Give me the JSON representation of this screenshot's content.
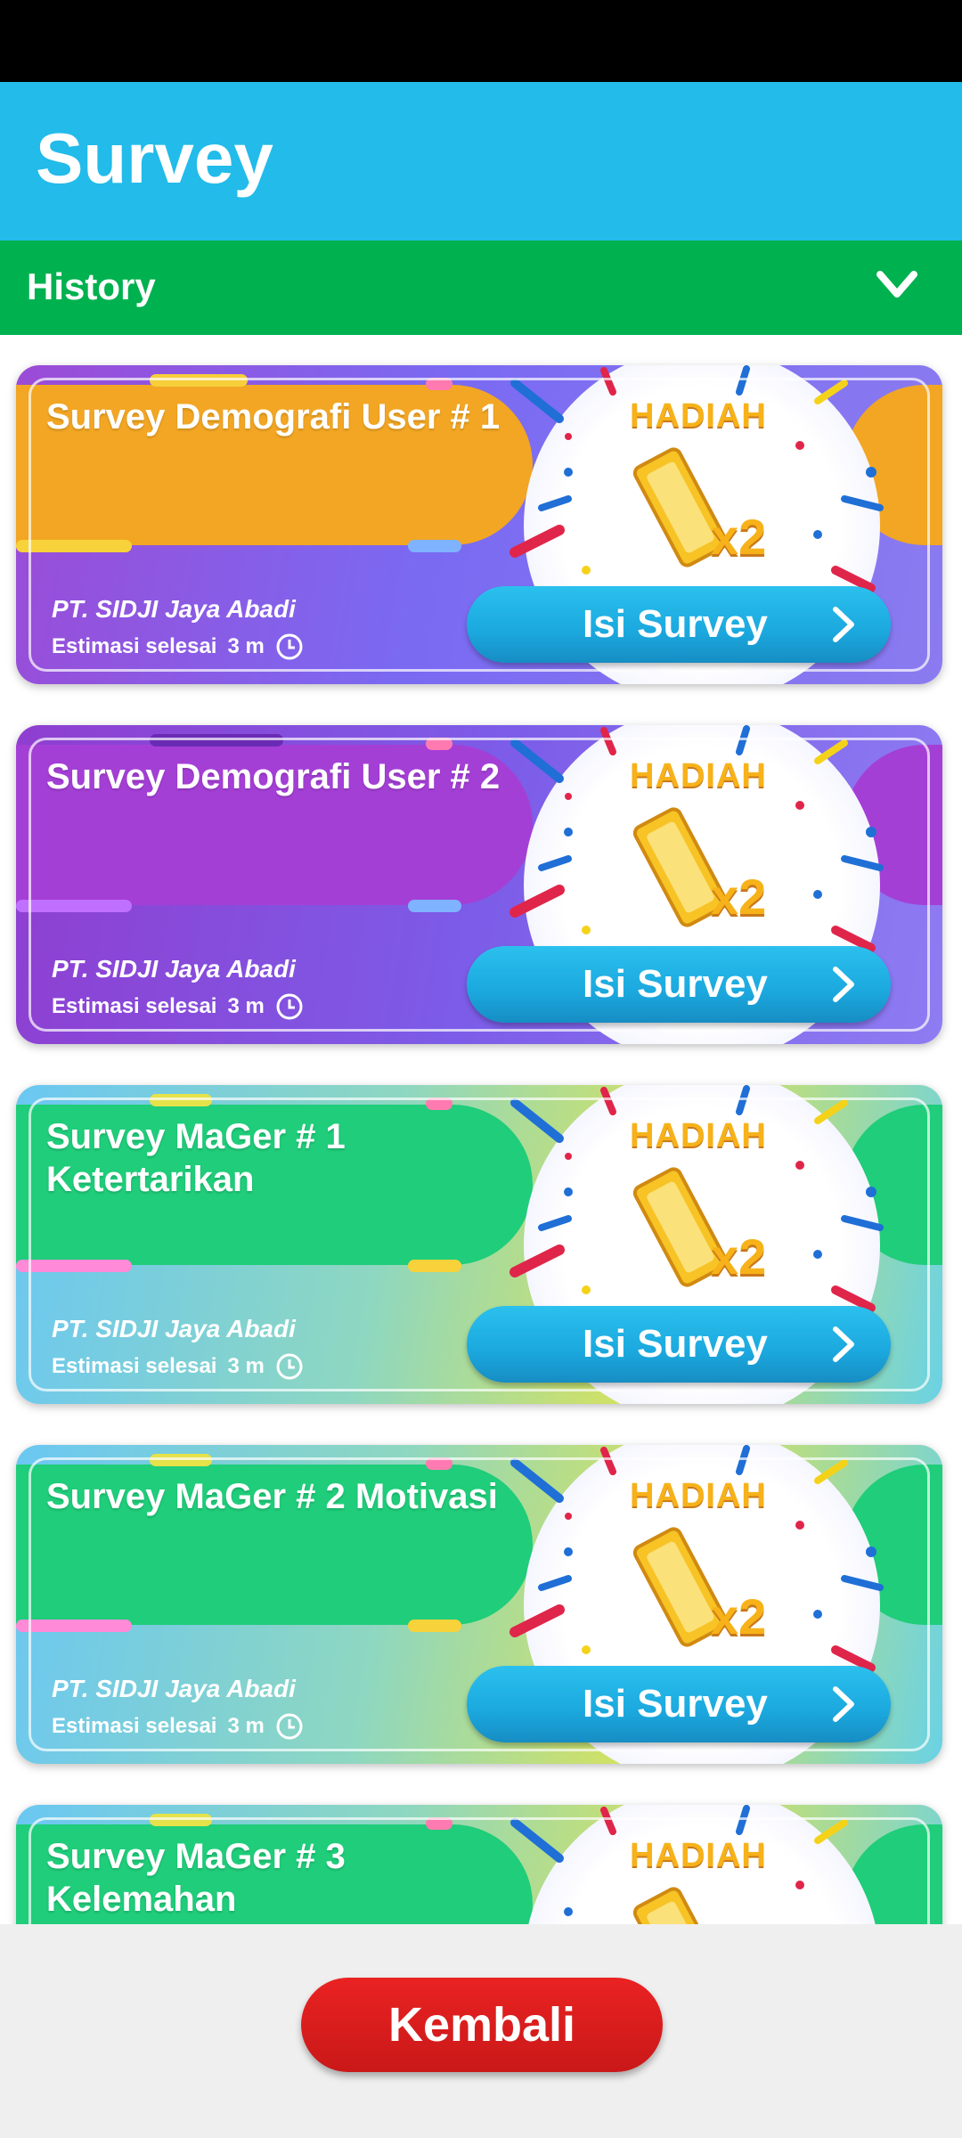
{
  "app": {
    "title": "Survey"
  },
  "history": {
    "label": "History"
  },
  "surveys": [
    {
      "title": "Survey Demografi User # 1",
      "company": "PT. SIDJI Jaya Abadi",
      "estimasi_label": "Estimasi selesai",
      "estimasi_value": "3 m",
      "prize_label": "HADIAH",
      "prize_multiplier": "x2",
      "button_label": "Isi Survey",
      "theme": "orange"
    },
    {
      "title": "Survey Demografi User # 2",
      "company": "PT. SIDJI Jaya Abadi",
      "estimasi_label": "Estimasi selesai",
      "estimasi_value": "3 m",
      "prize_label": "HADIAH",
      "prize_multiplier": "x2",
      "button_label": "Isi Survey",
      "theme": "purple"
    },
    {
      "title": "Survey MaGer # 1 Ketertarikan",
      "company": "PT. SIDJI Jaya Abadi",
      "estimasi_label": "Estimasi selesai",
      "estimasi_value": "3 m",
      "prize_label": "HADIAH",
      "prize_multiplier": "x2",
      "button_label": "Isi Survey",
      "theme": "green"
    },
    {
      "title": "Survey MaGer # 2 Motivasi",
      "company": "PT. SIDJI Jaya Abadi",
      "estimasi_label": "Estimasi selesai",
      "estimasi_value": "3 m",
      "prize_label": "HADIAH",
      "prize_multiplier": "x2",
      "button_label": "Isi Survey",
      "theme": "green"
    },
    {
      "title": "Survey MaGer # 3 Kelemahan",
      "company": "",
      "estimasi_label": "",
      "estimasi_value": "",
      "prize_label": "HADIAH",
      "prize_multiplier": "",
      "button_label": "",
      "theme": "green"
    }
  ],
  "footer": {
    "back_label": "Kembali"
  },
  "colors": {
    "appbar": "#22bbea",
    "history_bar": "#00b14f",
    "back_button": "#e02020",
    "prize_gold": "#f7b21a"
  }
}
